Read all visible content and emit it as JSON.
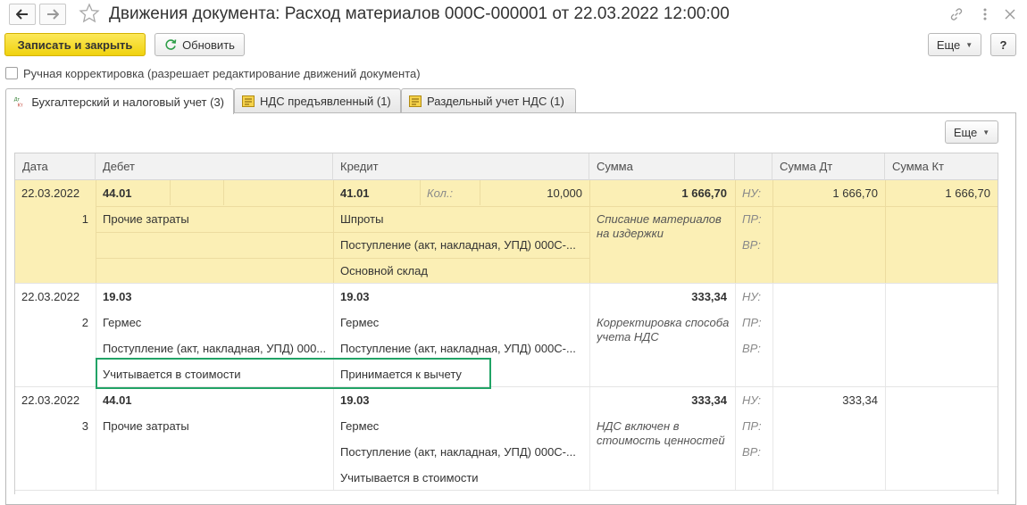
{
  "window": {
    "title": "Движения документа: Расход материалов 000С-000001 от 22.03.2022 12:00:00"
  },
  "toolbar": {
    "save_close": "Записать и закрыть",
    "refresh": "Обновить",
    "more": "Еще",
    "help": "?"
  },
  "manual": {
    "label": "Ручная корректировка (разрешает редактирование движений документа)",
    "checked": false
  },
  "tabs": [
    {
      "label": "Бухгалтерский и налоговый учет (3)",
      "active": true
    },
    {
      "label": "НДС предъявленный (1)",
      "active": false
    },
    {
      "label": "Раздельный учет НДС (1)",
      "active": false
    }
  ],
  "panel": {
    "more": "Еще"
  },
  "columns": {
    "date": "Дата",
    "debit": "Дебет",
    "credit": "Кредит",
    "sum": "Сумма",
    "sum_dt": "Сумма Дт",
    "sum_kt": "Сумма Кт"
  },
  "entries": [
    {
      "date": "22.03.2022",
      "num": "1",
      "debit_account": "44.01",
      "debit_sub": [
        "Прочие затраты",
        "",
        ""
      ],
      "credit_account": "41.01",
      "qty_label": "Кол.:",
      "qty_value": "10,000",
      "credit_sub": [
        "Шпроты",
        "Поступление (акт, накладная, УПД) 000С-...",
        "Основной склад"
      ],
      "sum": "1 666,70",
      "content": "Списание материалов на издержки",
      "nu_label": "НУ:",
      "pr_label": "ПР:",
      "vr_label": "ВР:",
      "sum_dt": "1 666,70",
      "sum_kt": "1 666,70"
    },
    {
      "date": "22.03.2022",
      "num": "2",
      "debit_account": "19.03",
      "debit_sub": [
        "Гермес",
        "Поступление (акт, накладная, УПД) 000...",
        "Учитывается в стоимости"
      ],
      "credit_account": "19.03",
      "credit_sub": [
        "Гермес",
        "Поступление (акт, накладная, УПД) 000С-...",
        "Принимается к вычету"
      ],
      "sum": "333,34",
      "content": "Корректировка способа учета НДС",
      "nu_label": "НУ:",
      "pr_label": "ПР:",
      "vr_label": "ВР:",
      "sum_dt": "",
      "sum_kt": ""
    },
    {
      "date": "22.03.2022",
      "num": "3",
      "debit_account": "44.01",
      "debit_sub": [
        "Прочие затраты",
        "",
        ""
      ],
      "credit_account": "19.03",
      "credit_sub": [
        "Гермес",
        "Поступление (акт, накладная, УПД) 000С-...",
        "Учитывается в стоимости"
      ],
      "sum": "333,34",
      "content": "НДС включен в стоимость ценностей",
      "nu_label": "НУ:",
      "pr_label": "ПР:",
      "vr_label": "ВР:",
      "sum_dt": "333,34",
      "sum_kt": ""
    }
  ],
  "colors": {
    "primary_button": "#f0d20e",
    "selected_row": "#fbefb5",
    "highlight_frame": "#21a366"
  }
}
